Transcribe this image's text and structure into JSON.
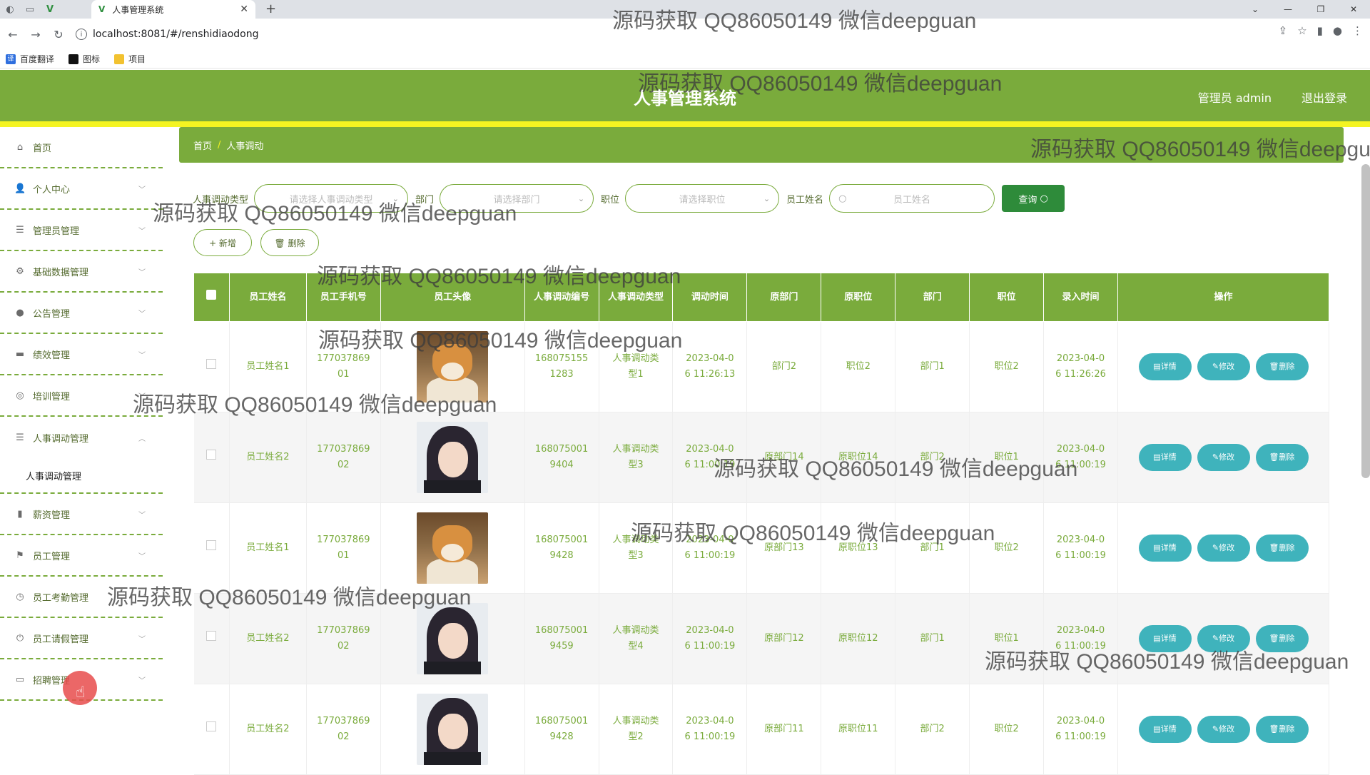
{
  "browser": {
    "tab_title": "人事管理系统",
    "url": "localhost:8081/#/renshidiaodong",
    "bookmarks": [
      "百度翻译",
      "图标",
      "项目"
    ]
  },
  "header": {
    "title": "人事管理系统",
    "user": "管理员 admin",
    "logout": "退出登录",
    "accent_color": "#7aab3c"
  },
  "sidebar": {
    "items": [
      {
        "label": "首页",
        "icon": "home-icon"
      },
      {
        "label": "个人中心",
        "icon": "user-icon"
      },
      {
        "label": "管理员管理",
        "icon": "list-icon"
      },
      {
        "label": "基础数据管理",
        "icon": "settings-icon"
      },
      {
        "label": "公告管理",
        "icon": "pin-icon"
      },
      {
        "label": "绩效管理",
        "icon": "chat-icon"
      },
      {
        "label": "培训管理",
        "icon": "compass-icon"
      },
      {
        "label": "人事调动管理",
        "icon": "list-icon"
      },
      {
        "label": "薪资管理",
        "icon": "chart-icon"
      },
      {
        "label": "员工管理",
        "icon": "flag-icon"
      },
      {
        "label": "员工考勤管理",
        "icon": "clock-icon"
      },
      {
        "label": "员工请假管理",
        "icon": "power-icon"
      },
      {
        "label": "招聘管理",
        "icon": "card-icon"
      }
    ],
    "sub_item": "人事调动管理"
  },
  "breadcrumb": {
    "home": "首页",
    "sep": "/",
    "current": "人事调动"
  },
  "search": {
    "type_label": "人事调动类型",
    "type_placeholder": "请选择人事调动类型",
    "dept_label": "部门",
    "dept_placeholder": "请选择部门",
    "pos_label": "职位",
    "pos_placeholder": "请选择职位",
    "name_label": "员工姓名",
    "name_placeholder": "员工姓名",
    "query": "查询"
  },
  "actions": {
    "add": "+ 新增",
    "delete": "🗑 删除"
  },
  "table": {
    "headers": [
      "员工姓名",
      "员工手机号",
      "员工头像",
      "人事调动编号",
      "人事调动类型",
      "调动时间",
      "原部门",
      "原职位",
      "部门",
      "职位",
      "录入时间",
      "操作"
    ],
    "op_labels": {
      "detail": "详情",
      "edit": "修改",
      "delete": "删除"
    },
    "rows": [
      {
        "name": "员工姓名1",
        "phone": "17703786901",
        "avatar": "dog",
        "no": "1680751551283",
        "type": "人事调动类型1",
        "time": "2023-04-06 11:26:13",
        "old_dept": "部门2",
        "old_pos": "职位2",
        "dept": "部门1",
        "pos": "职位2",
        "created": "2023-04-06 11:26:26"
      },
      {
        "name": "员工姓名2",
        "phone": "17703786902",
        "avatar": "girl",
        "no": "1680750019404",
        "type": "人事调动类型3",
        "time": "2023-04-06 11:00:19",
        "old_dept": "原部门14",
        "old_pos": "原职位14",
        "dept": "部门2",
        "pos": "职位1",
        "created": "2023-04-06 11:00:19"
      },
      {
        "name": "员工姓名1",
        "phone": "17703786901",
        "avatar": "dog",
        "no": "1680750019428",
        "type": "人事调动类型3",
        "time": "2023-04-06 11:00:19",
        "old_dept": "原部门13",
        "old_pos": "原职位13",
        "dept": "部门1",
        "pos": "职位2",
        "created": "2023-04-06 11:00:19"
      },
      {
        "name": "员工姓名2",
        "phone": "17703786902",
        "avatar": "girl",
        "no": "1680750019459",
        "type": "人事调动类型4",
        "time": "2023-04-06 11:00:19",
        "old_dept": "原部门12",
        "old_pos": "原职位12",
        "dept": "部门1",
        "pos": "职位1",
        "created": "2023-04-06 11:00:19"
      },
      {
        "name": "员工姓名2",
        "phone": "17703786902",
        "avatar": "girl",
        "no": "1680750019428",
        "type": "人事调动类型2",
        "time": "2023-04-06 11:00:19",
        "old_dept": "原部门11",
        "old_pos": "原职位11",
        "dept": "部门2",
        "pos": "职位2",
        "created": "2023-04-06 11:00:19"
      }
    ]
  },
  "watermark": "源码获取 QQ86050149 微信deepguan"
}
